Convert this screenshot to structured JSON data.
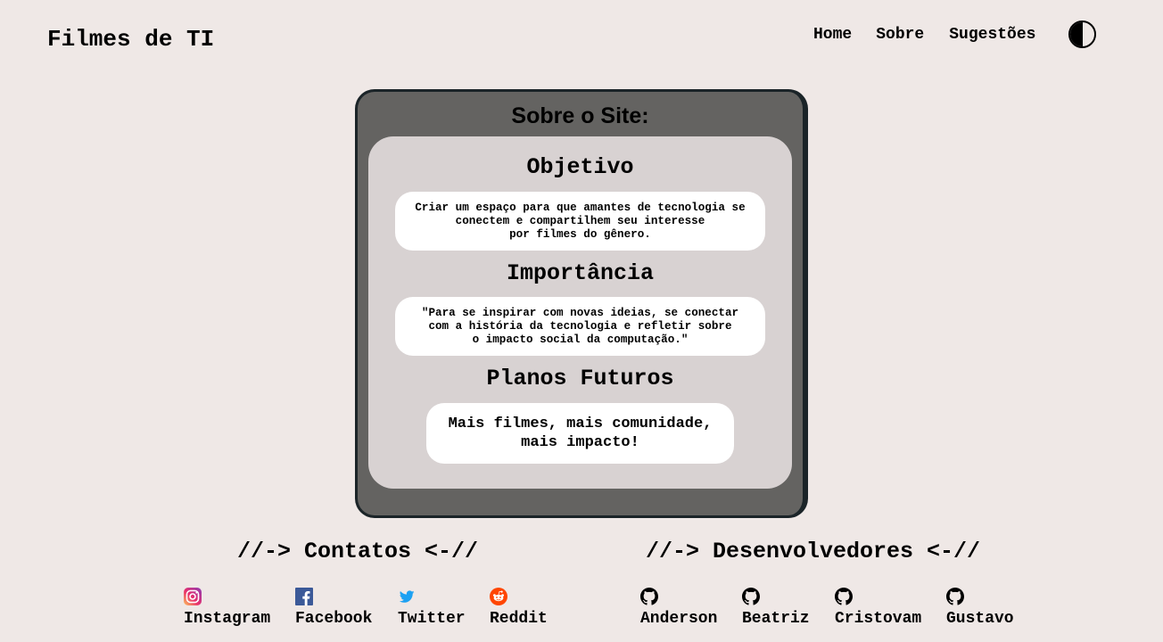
{
  "header": {
    "site_title": "Filmes de TI",
    "nav": {
      "home": "Home",
      "sobre": "Sobre",
      "sugestoes": "Sugestões"
    },
    "theme_toggle_icon": "contrast-icon"
  },
  "about": {
    "title": "Sobre o Site:",
    "sections": [
      {
        "heading": "Objetivo",
        "text": "Criar um espaço para que amantes de tecnologia se\nconectem e compartilhem seu interesse\npor filmes do gênero."
      },
      {
        "heading": "Importância",
        "text": "\"Para se inspirar com novas ideias, se conectar\ncom a história da tecnologia e refletir sobre\no impacto social da computação.\""
      },
      {
        "heading": "Planos Futuros",
        "text": "Mais filmes, mais comunidade,\nmais impacto!"
      }
    ]
  },
  "footer": {
    "contacts_heading": "//-> Contatos <-//",
    "contacts": [
      {
        "label": "Instagram",
        "icon": "instagram-icon"
      },
      {
        "label": "Facebook",
        "icon": "facebook-icon"
      },
      {
        "label": "Twitter",
        "icon": "twitter-icon"
      },
      {
        "label": "Reddit",
        "icon": "reddit-icon"
      }
    ],
    "devs_heading": "//-> Desenvolvedores <-//",
    "devs": [
      {
        "label": "Anderson",
        "icon": "github-icon"
      },
      {
        "label": "Beatriz",
        "icon": "github-icon"
      },
      {
        "label": "Cristovam",
        "icon": "github-icon"
      },
      {
        "label": "Gustavo",
        "icon": "github-icon"
      }
    ]
  },
  "colors": {
    "page_background": "#efe8e6",
    "about_box": "#646361",
    "about_border": "#1b2428",
    "about_inner": "#d8d2d2",
    "card": "#ffffff"
  }
}
